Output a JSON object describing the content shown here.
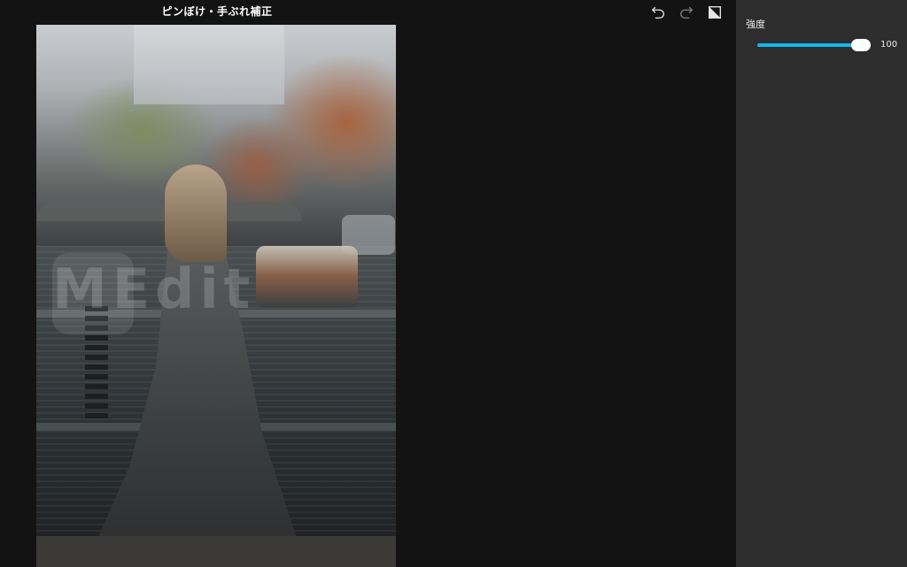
{
  "editor": {
    "title": "ピンぼけ・手ぶれ補正"
  },
  "toolbar": {
    "undo_icon": "undo-icon",
    "redo_icon": "redo-icon",
    "compare_icon": "compare-icon"
  },
  "photo": {
    "watermark": "MEdit"
  },
  "panel": {
    "strength_label": "強度",
    "strength_value": "100",
    "strength_fraction": 1.0,
    "accent_color": "#12b7ee"
  }
}
